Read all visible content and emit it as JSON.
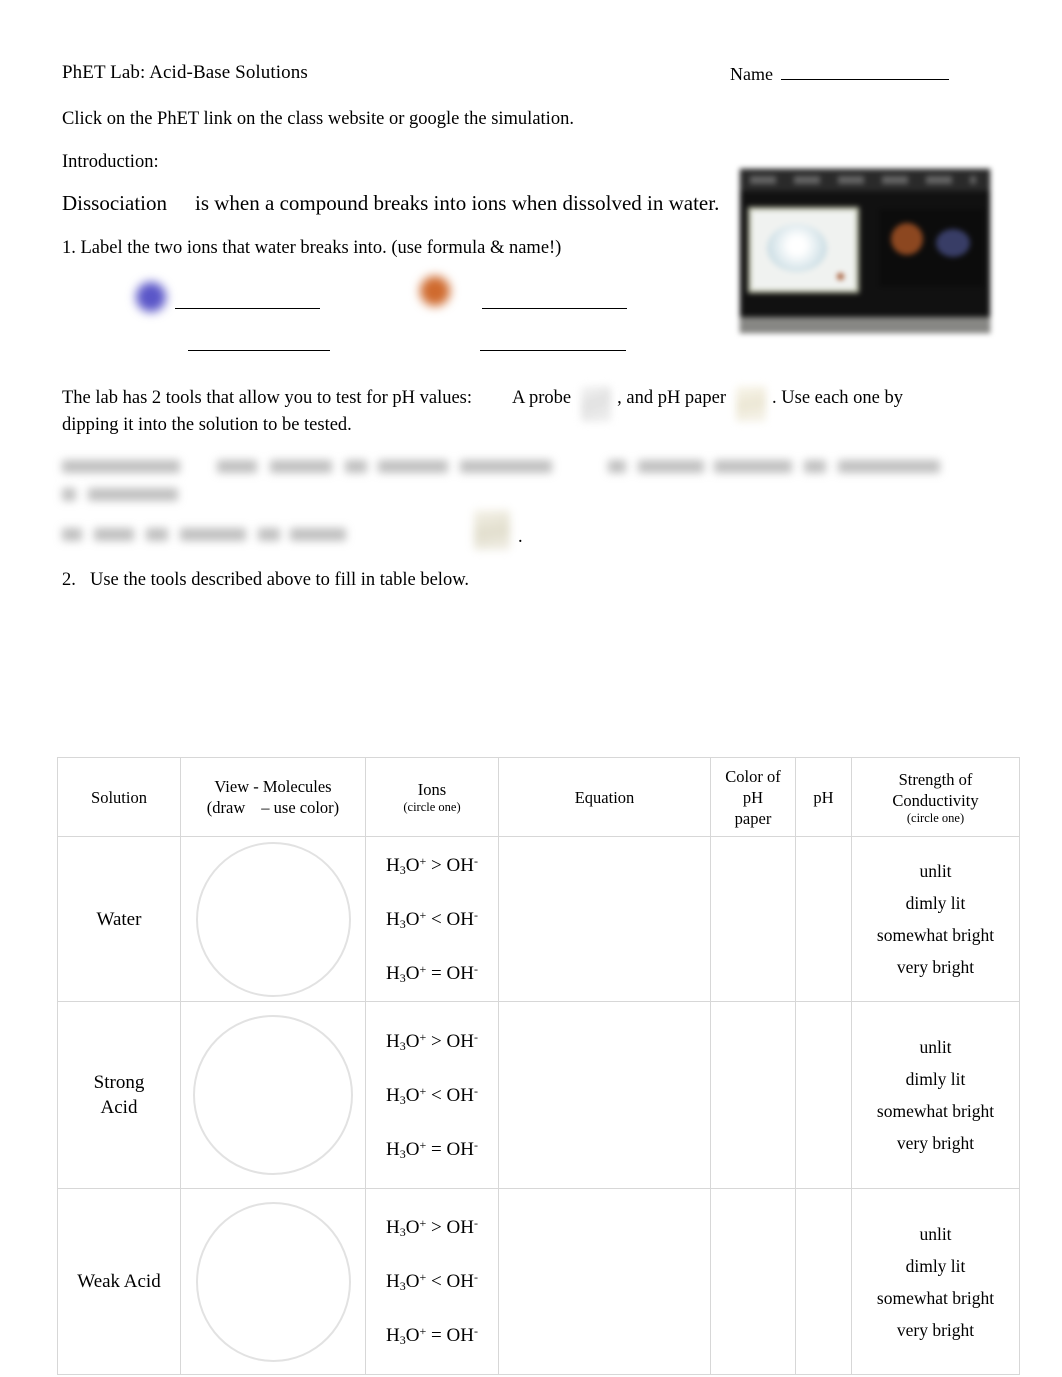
{
  "header": {
    "title": "PhET Lab: Acid-Base Solutions",
    "name_label": "Name"
  },
  "intro": {
    "click_line": "Click on the PhET link on the class website or google the simulation.",
    "introduction_label": "Introduction:",
    "dissociation_term": "Dissociation",
    "dissociation_definition": "is when a compound breaks into ions when dissolved in water.",
    "question_1": "1. Label the two ions that water breaks into. (use formula & name!)",
    "ion_dot_blue_color": "#5a56c8",
    "ion_dot_orange_color": "#cf6a2e"
  },
  "tools": {
    "sentence_part_1": "The lab has 2 tools that allow you to test for pH values:",
    "sentence_part_2": "A probe",
    "sentence_part_3": ", and pH paper",
    "sentence_part_4": ".  Use each one by",
    "sentence_part_5": "dipping it into the solution to be tested.",
    "trailing_period": "."
  },
  "question_2": {
    "number": "2.",
    "text": "Use the tools described above to fill in table below."
  },
  "table": {
    "headers": {
      "solution": "Solution",
      "view_line1": "View - Molecules",
      "view_line2_a": "(draw",
      "view_line2_b": "– use color)",
      "ions": "Ions",
      "ions_sub": "(circle one)",
      "equation": "Equation",
      "color_line1": "Color of",
      "color_line2": "pH",
      "color_line3": "paper",
      "ph": "pH",
      "conductivity_line1": "Strength of",
      "conductivity_line2": "Conductivity",
      "conductivity_sub": "(circle one)"
    },
    "ion_options": [
      {
        "left": "H",
        "left_sub": "3",
        "left_el": "O",
        "left_sup": "+",
        "op": ">",
        "right": "OH",
        "right_sup": "-"
      },
      {
        "left": "H",
        "left_sub": "3",
        "left_el": "O",
        "left_sup": "+",
        "op": "<",
        "right": "OH",
        "right_sup": "-"
      },
      {
        "left": "H",
        "left_sub": "3",
        "left_el": "O",
        "left_sup": "+",
        "op": "=",
        "right": "OH",
        "right_sup": "-"
      }
    ],
    "conductivity_options": [
      "unlit",
      "dimly lit",
      "somewhat bright",
      "very bright"
    ],
    "rows": [
      {
        "solution_line1": "Water",
        "solution_line2": ""
      },
      {
        "solution_line1": "Strong",
        "solution_line2": "Acid"
      },
      {
        "solution_line1": "Weak Acid",
        "solution_line2": ""
      }
    ]
  }
}
